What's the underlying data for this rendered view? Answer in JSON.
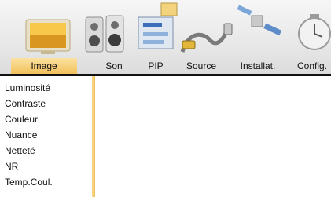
{
  "tabs": [
    {
      "label": "Image",
      "active": true,
      "icon": "tv-monitor-icon"
    },
    {
      "label": "Son",
      "active": false,
      "icon": "speakers-icon"
    },
    {
      "label": "PIP",
      "active": false,
      "icon": "picture-in-picture-icon"
    },
    {
      "label": "Source",
      "active": false,
      "icon": "cable-plug-icon"
    },
    {
      "label": "Installat.",
      "active": false,
      "icon": "satellite-icon"
    },
    {
      "label": "Config.",
      "active": false,
      "icon": "clock-icon"
    }
  ],
  "menu": {
    "items": [
      "Luminosité",
      "Contraste",
      "Couleur",
      "Nuance",
      "Netteté",
      "NR",
      "Temp.Coul."
    ]
  },
  "colors": {
    "active_tab": "#f2c15c",
    "rail": "#f1c05a",
    "divider": "#111111"
  }
}
